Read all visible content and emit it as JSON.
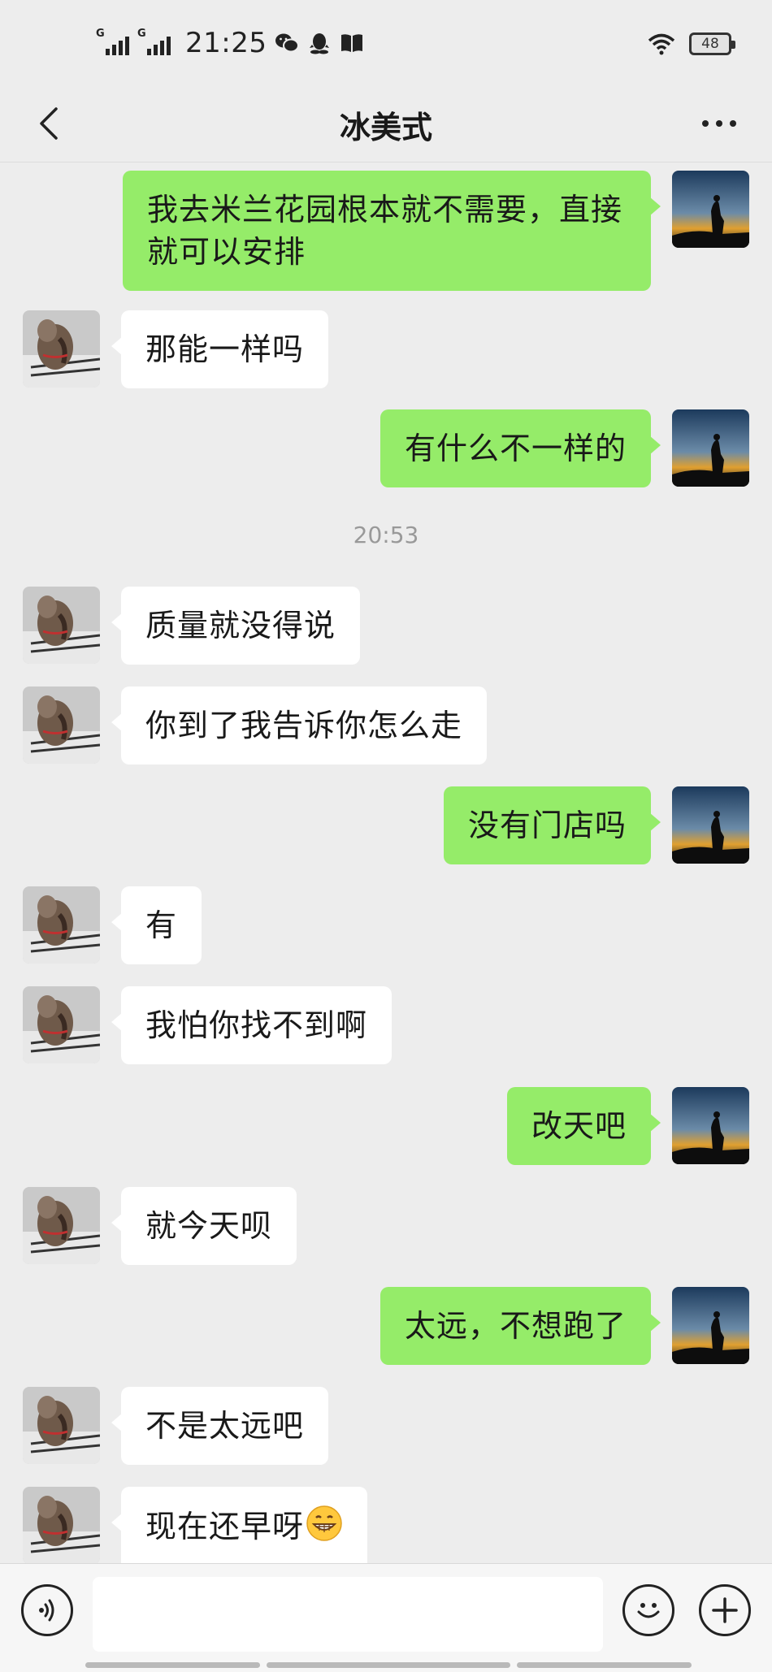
{
  "status_bar": {
    "network_1": "G",
    "network_2": "G",
    "time": "21:25",
    "battery": "48",
    "icons": [
      "signal-icon",
      "signal-icon",
      "wechat-icon",
      "qq-icon",
      "book-icon",
      "wifi-icon",
      "battery-icon"
    ]
  },
  "nav": {
    "title": "冰美式",
    "back_icon": "chevron-left-icon",
    "more_icon": "more-horizontal-icon"
  },
  "messages": [
    {
      "side": "mine",
      "text": "我去米兰花园根本就不需要，直接就可以安排"
    },
    {
      "side": "theirs",
      "text": "那能一样吗"
    },
    {
      "side": "mine",
      "text": "有什么不一样的"
    },
    {
      "timestamp": "20:53"
    },
    {
      "side": "theirs",
      "text": "质量就没得说"
    },
    {
      "side": "theirs",
      "text": "你到了我告诉你怎么走"
    },
    {
      "side": "mine",
      "text": "没有门店吗"
    },
    {
      "side": "theirs",
      "text": "有"
    },
    {
      "side": "theirs",
      "text": "我怕你找不到啊"
    },
    {
      "side": "mine",
      "text": "改天吧"
    },
    {
      "side": "theirs",
      "text": "就今天呗"
    },
    {
      "side": "mine",
      "text": "太远，不想跑了"
    },
    {
      "side": "theirs",
      "text": "不是太远吧"
    },
    {
      "side": "theirs",
      "text": "现在还早呀",
      "emoji": "grinning-emoji"
    }
  ],
  "input_bar": {
    "voice_icon": "voice-icon",
    "input_value": "",
    "emoji_icon": "smile-icon",
    "plus_icon": "plus-icon"
  },
  "colors": {
    "background": "#ededed",
    "bubble_mine": "#95ec69",
    "bubble_theirs": "#ffffff",
    "timestamp_text": "#999999"
  }
}
